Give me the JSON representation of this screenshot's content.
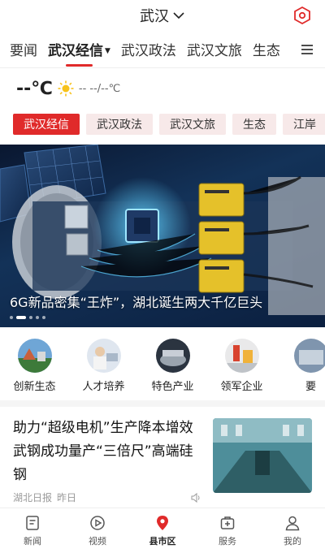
{
  "header": {
    "city": "武汉"
  },
  "tabs": [
    {
      "label": "要闻"
    },
    {
      "label": "武汉经信"
    },
    {
      "label": "武汉政法"
    },
    {
      "label": "武汉文旅"
    },
    {
      "label": "生态"
    }
  ],
  "weather": {
    "temp": "--℃",
    "text": "--  --/--℃"
  },
  "chips": [
    {
      "label": "武汉经信"
    },
    {
      "label": "武汉政法"
    },
    {
      "label": "武汉文旅"
    },
    {
      "label": "生态"
    },
    {
      "label": "江岸"
    }
  ],
  "hero": {
    "caption": "6G新品密集“王炸”，湖北诞生两大千亿巨头"
  },
  "categories": [
    {
      "label": "创新生态"
    },
    {
      "label": "人才培养"
    },
    {
      "label": "特色产业"
    },
    {
      "label": "领军企业"
    },
    {
      "label": "要"
    }
  ],
  "news": [
    {
      "title": "助力“超级电机”生产降本增效 武钢成功量产“三倍尺”高端硅钢",
      "source": "湖北日报",
      "time": "昨日"
    }
  ],
  "bottom_nav": [
    {
      "label": "新闻"
    },
    {
      "label": "视频"
    },
    {
      "label": "县市区"
    },
    {
      "label": "服务"
    },
    {
      "label": "我的"
    }
  ],
  "colors": {
    "accent": "#e02a2a",
    "chip_bg": "#f7e9e9"
  }
}
